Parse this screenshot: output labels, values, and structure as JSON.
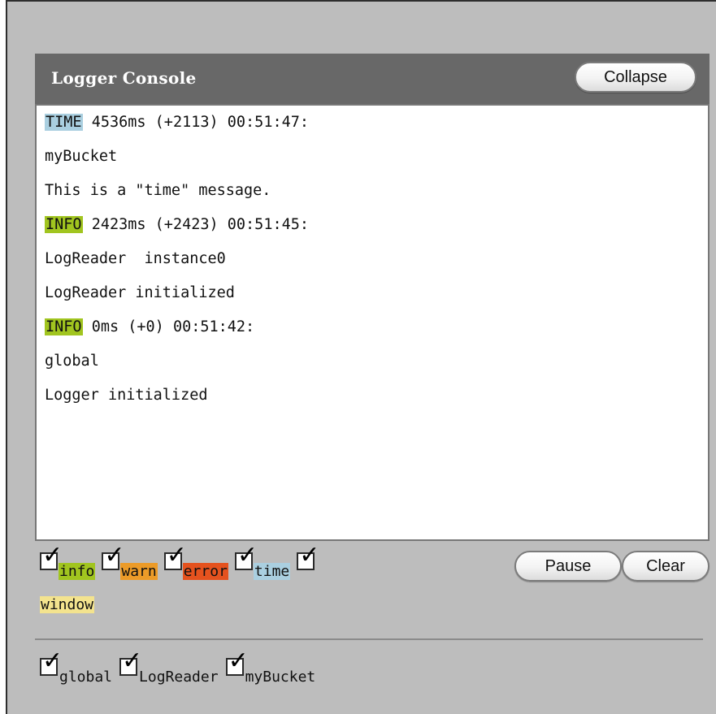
{
  "console": {
    "title": "Logger Console",
    "collapse_label": "Collapse",
    "lines": [
      {
        "kind": "header",
        "category": "TIME",
        "category_color": "#aacfe0",
        "text": " 4536ms (+2113) 00:51:47:"
      },
      {
        "kind": "text",
        "text": "myBucket"
      },
      {
        "kind": "text",
        "text": "This is a \"time\" message."
      },
      {
        "kind": "header",
        "category": "INFO",
        "category_color": "#a1c51f",
        "text": " 2423ms (+2423) 00:51:45:"
      },
      {
        "kind": "text",
        "text": "LogReader  instance0"
      },
      {
        "kind": "text",
        "text": "LogReader initialized"
      },
      {
        "kind": "header",
        "category": "INFO",
        "category_color": "#a1c51f",
        "text": " 0ms (+0) 00:51:42:"
      },
      {
        "kind": "text",
        "text": "global"
      },
      {
        "kind": "text",
        "text": "Logger initialized"
      }
    ]
  },
  "filters": {
    "categories": [
      {
        "label": "info",
        "color": "#a1c51f",
        "checked": true
      },
      {
        "label": "warn",
        "color": "#ec9b28",
        "checked": true
      },
      {
        "label": "error",
        "color": "#e5521e",
        "checked": true
      },
      {
        "label": "time",
        "color": "#aacfe0",
        "checked": true
      },
      {
        "label": "window",
        "color": "#f3e38e",
        "checked": true
      }
    ],
    "pause_label": "Pause",
    "clear_label": "Clear"
  },
  "sources": [
    {
      "label": "global",
      "checked": true
    },
    {
      "label": "LogReader",
      "checked": true
    },
    {
      "label": "myBucket",
      "checked": true
    }
  ],
  "icons": {
    "checkbox": "checkbox-checked-icon"
  }
}
